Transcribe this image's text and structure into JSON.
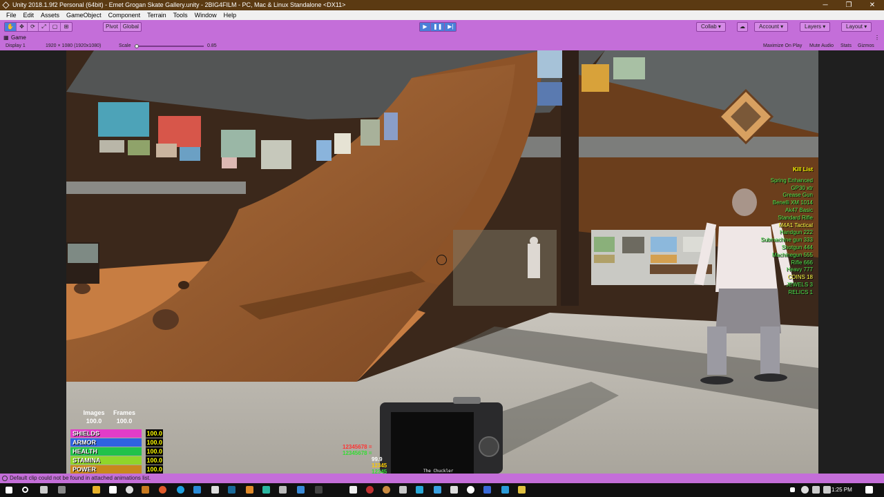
{
  "window": {
    "title": "Unity 2018.1.9f2 Personal (64bit) - Emet Grogan Skate Gallery.unity - 2BIG4FILM - PC, Mac & Linux Standalone <DX11>",
    "minimize": "─",
    "restore": "❐",
    "close": "✕"
  },
  "menu": [
    "File",
    "Edit",
    "Assets",
    "GameObject",
    "Component",
    "Terrain",
    "Tools",
    "Window",
    "Help"
  ],
  "toolbar": {
    "tools": [
      "✋",
      "✥",
      "⟳",
      "⤢",
      "▢",
      "⊞"
    ],
    "pivot": "Pivot",
    "global": "Global",
    "play": "▶",
    "pause": "❚❚",
    "step": "▶|",
    "collab": "Collab",
    "cloud": "☁",
    "account": "Account",
    "layers": "Layers",
    "layout": "Layout"
  },
  "game_tab": {
    "label": "Game",
    "display": "Display 1",
    "resolution": "1920 × 1080 (1920x1080)",
    "scale_label": "Scale",
    "scale_value": "0.85",
    "scale_fraction": 0.85,
    "maximize": "Maximize On Play",
    "mute": "Mute Audio",
    "stats": "Stats",
    "gizmos": "Gizmos"
  },
  "hud": {
    "images_label": "Images",
    "frames_label": "Frames",
    "images_value": "100.0",
    "frames_value": "100.0",
    "bars": [
      {
        "label": "SHIELDS",
        "value": "100.0",
        "color": "#e23cc8"
      },
      {
        "label": "ARMOR",
        "value": "100.0",
        "color": "#2f62e0"
      },
      {
        "label": "HEALTH",
        "value": "100.0",
        "color": "#21c24a"
      },
      {
        "label": "STAMINA",
        "value": "100.0",
        "color": "#8fd62b"
      },
      {
        "label": "POWER",
        "value": "100.0",
        "color": "#c8881c"
      }
    ],
    "kill_list_title": "Kill List",
    "kill_list": [
      {
        "text": "Spring Enhanced",
        "color": "#4ee84e"
      },
      {
        "text": "GP30 xtr",
        "color": "#4ee84e"
      },
      {
        "text": "Grease Gun",
        "color": "#4ee84e"
      },
      {
        "text": "Benelli XM 1014",
        "color": "#4ee84e"
      },
      {
        "text": "Ak47 Basic",
        "color": "#4ee84e"
      },
      {
        "text": "Standard Rifle",
        "color": "#4ee84e"
      },
      {
        "text": "M4A1 Tactical",
        "color": "#ffff44"
      },
      {
        "text": "Handgun 222",
        "color": "#4ee84e"
      },
      {
        "text": "Submachine gun 333",
        "color": "#4ee84e"
      },
      {
        "text": "Shotgun 444",
        "color": "#4ee84e"
      },
      {
        "text": "Machinegun 555",
        "color": "#4ee84e"
      },
      {
        "text": "Rifle 666",
        "color": "#4ee84e"
      },
      {
        "text": "Heavy 777",
        "color": "#4ee84e"
      },
      {
        "text": "COINS 18",
        "color": "#ffff44"
      },
      {
        "text": "JEWELS 3",
        "color": "#4ee84e"
      },
      {
        "text": "RELICS 1",
        "color": "#4ee84e"
      }
    ],
    "ammo_lines": [
      {
        "text": "12345678 =",
        "color": "#ff3333"
      },
      {
        "text": "12345678 =",
        "color": "#33dd33"
      },
      {
        "text": "99.9",
        "color": "#ffffff"
      },
      {
        "text": "12345",
        "color": "#ffcc00"
      },
      {
        "text": "12345",
        "color": "#33dd33"
      }
    ],
    "camera_label": "The Chuckler"
  },
  "status": {
    "message": "Default clip could not be found in attached animations list."
  },
  "taskbar": {
    "time": "1:25 PM"
  }
}
